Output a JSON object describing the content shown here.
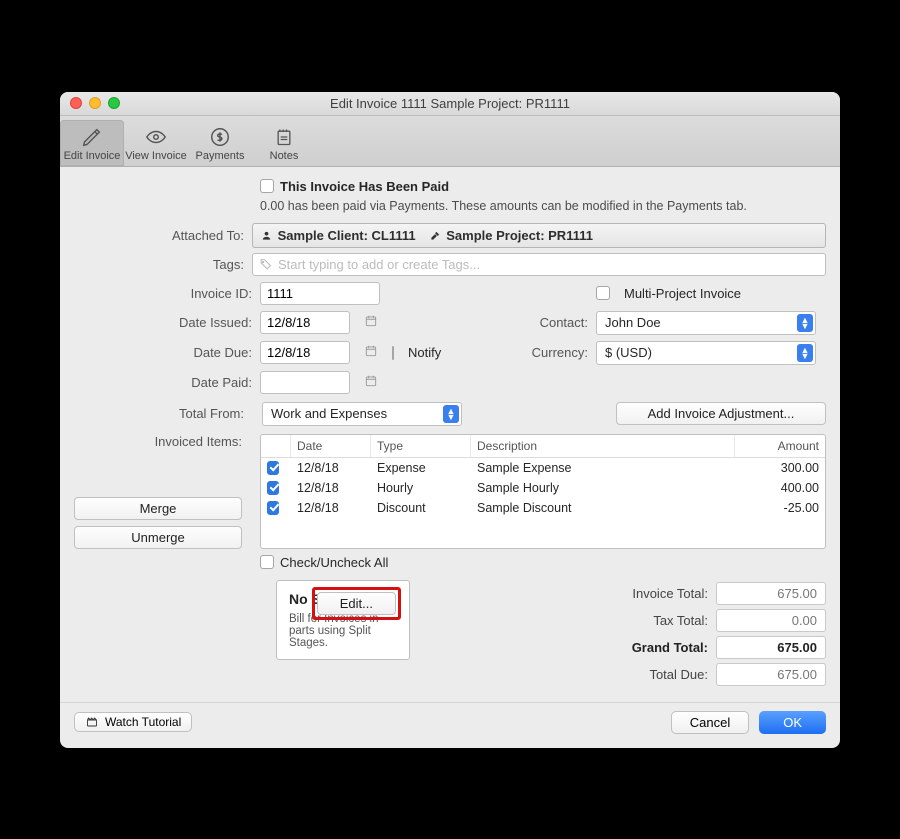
{
  "window": {
    "title": "Edit Invoice 1111 Sample Project: PR1111"
  },
  "toolbar": {
    "edit": "Edit Invoice",
    "view": "View Invoice",
    "payments": "Payments",
    "notes": "Notes"
  },
  "paid_section": {
    "checkbox_label": "This Invoice Has Been Paid",
    "note": "0.00 has been paid via Payments. These amounts can be modified in the Payments tab."
  },
  "labels": {
    "attached_to": "Attached To:",
    "tags": "Tags:",
    "tags_placeholder": "Start typing to add or create Tags...",
    "invoice_id": "Invoice ID:",
    "date_issued": "Date Issued:",
    "date_due": "Date Due:",
    "date_paid": "Date Paid:",
    "notify": "Notify",
    "multi_project": "Multi-Project Invoice",
    "contact": "Contact:",
    "currency": "Currency:",
    "total_from": "Total From:",
    "invoiced_items": "Invoiced Items:",
    "merge": "Merge",
    "unmerge": "Unmerge",
    "check_all": "Check/Uncheck All",
    "add_adjustment": "Add Invoice Adjustment...",
    "invoice_total": "Invoice Total:",
    "tax_total": "Tax Total:",
    "grand_total": "Grand Total:",
    "total_due": "Total Due:"
  },
  "attached": {
    "client": "Sample Client: CL1111",
    "project": "Sample Project: PR1111"
  },
  "fields": {
    "invoice_id": "1111",
    "date_issued": "12/8/18",
    "date_due": "12/8/18",
    "date_paid": "",
    "contact": "John Doe",
    "currency": "$ (USD)",
    "total_from": "Work and Expenses"
  },
  "items_header": {
    "date": "Date",
    "type": "Type",
    "description": "Description",
    "amount": "Amount"
  },
  "items": [
    {
      "checked": true,
      "date": "12/8/18",
      "type": "Expense",
      "description": "Sample Expense",
      "amount": "300.00"
    },
    {
      "checked": true,
      "date": "12/8/18",
      "type": "Hourly",
      "description": "Sample Hourly",
      "amount": "400.00"
    },
    {
      "checked": true,
      "date": "12/8/18",
      "type": "Discount",
      "description": "Sample Discount",
      "amount": "-25.00"
    }
  ],
  "totals": {
    "invoice_total": "675.00",
    "tax_total": "0.00",
    "grand_total": "675.00",
    "total_due": "675.00"
  },
  "split": {
    "title": "No Split Stages",
    "subtitle": "Bill for Invoices in parts using Split Stages.",
    "edit": "Edit..."
  },
  "footer": {
    "watch": "Watch Tutorial",
    "cancel": "Cancel",
    "ok": "OK"
  }
}
